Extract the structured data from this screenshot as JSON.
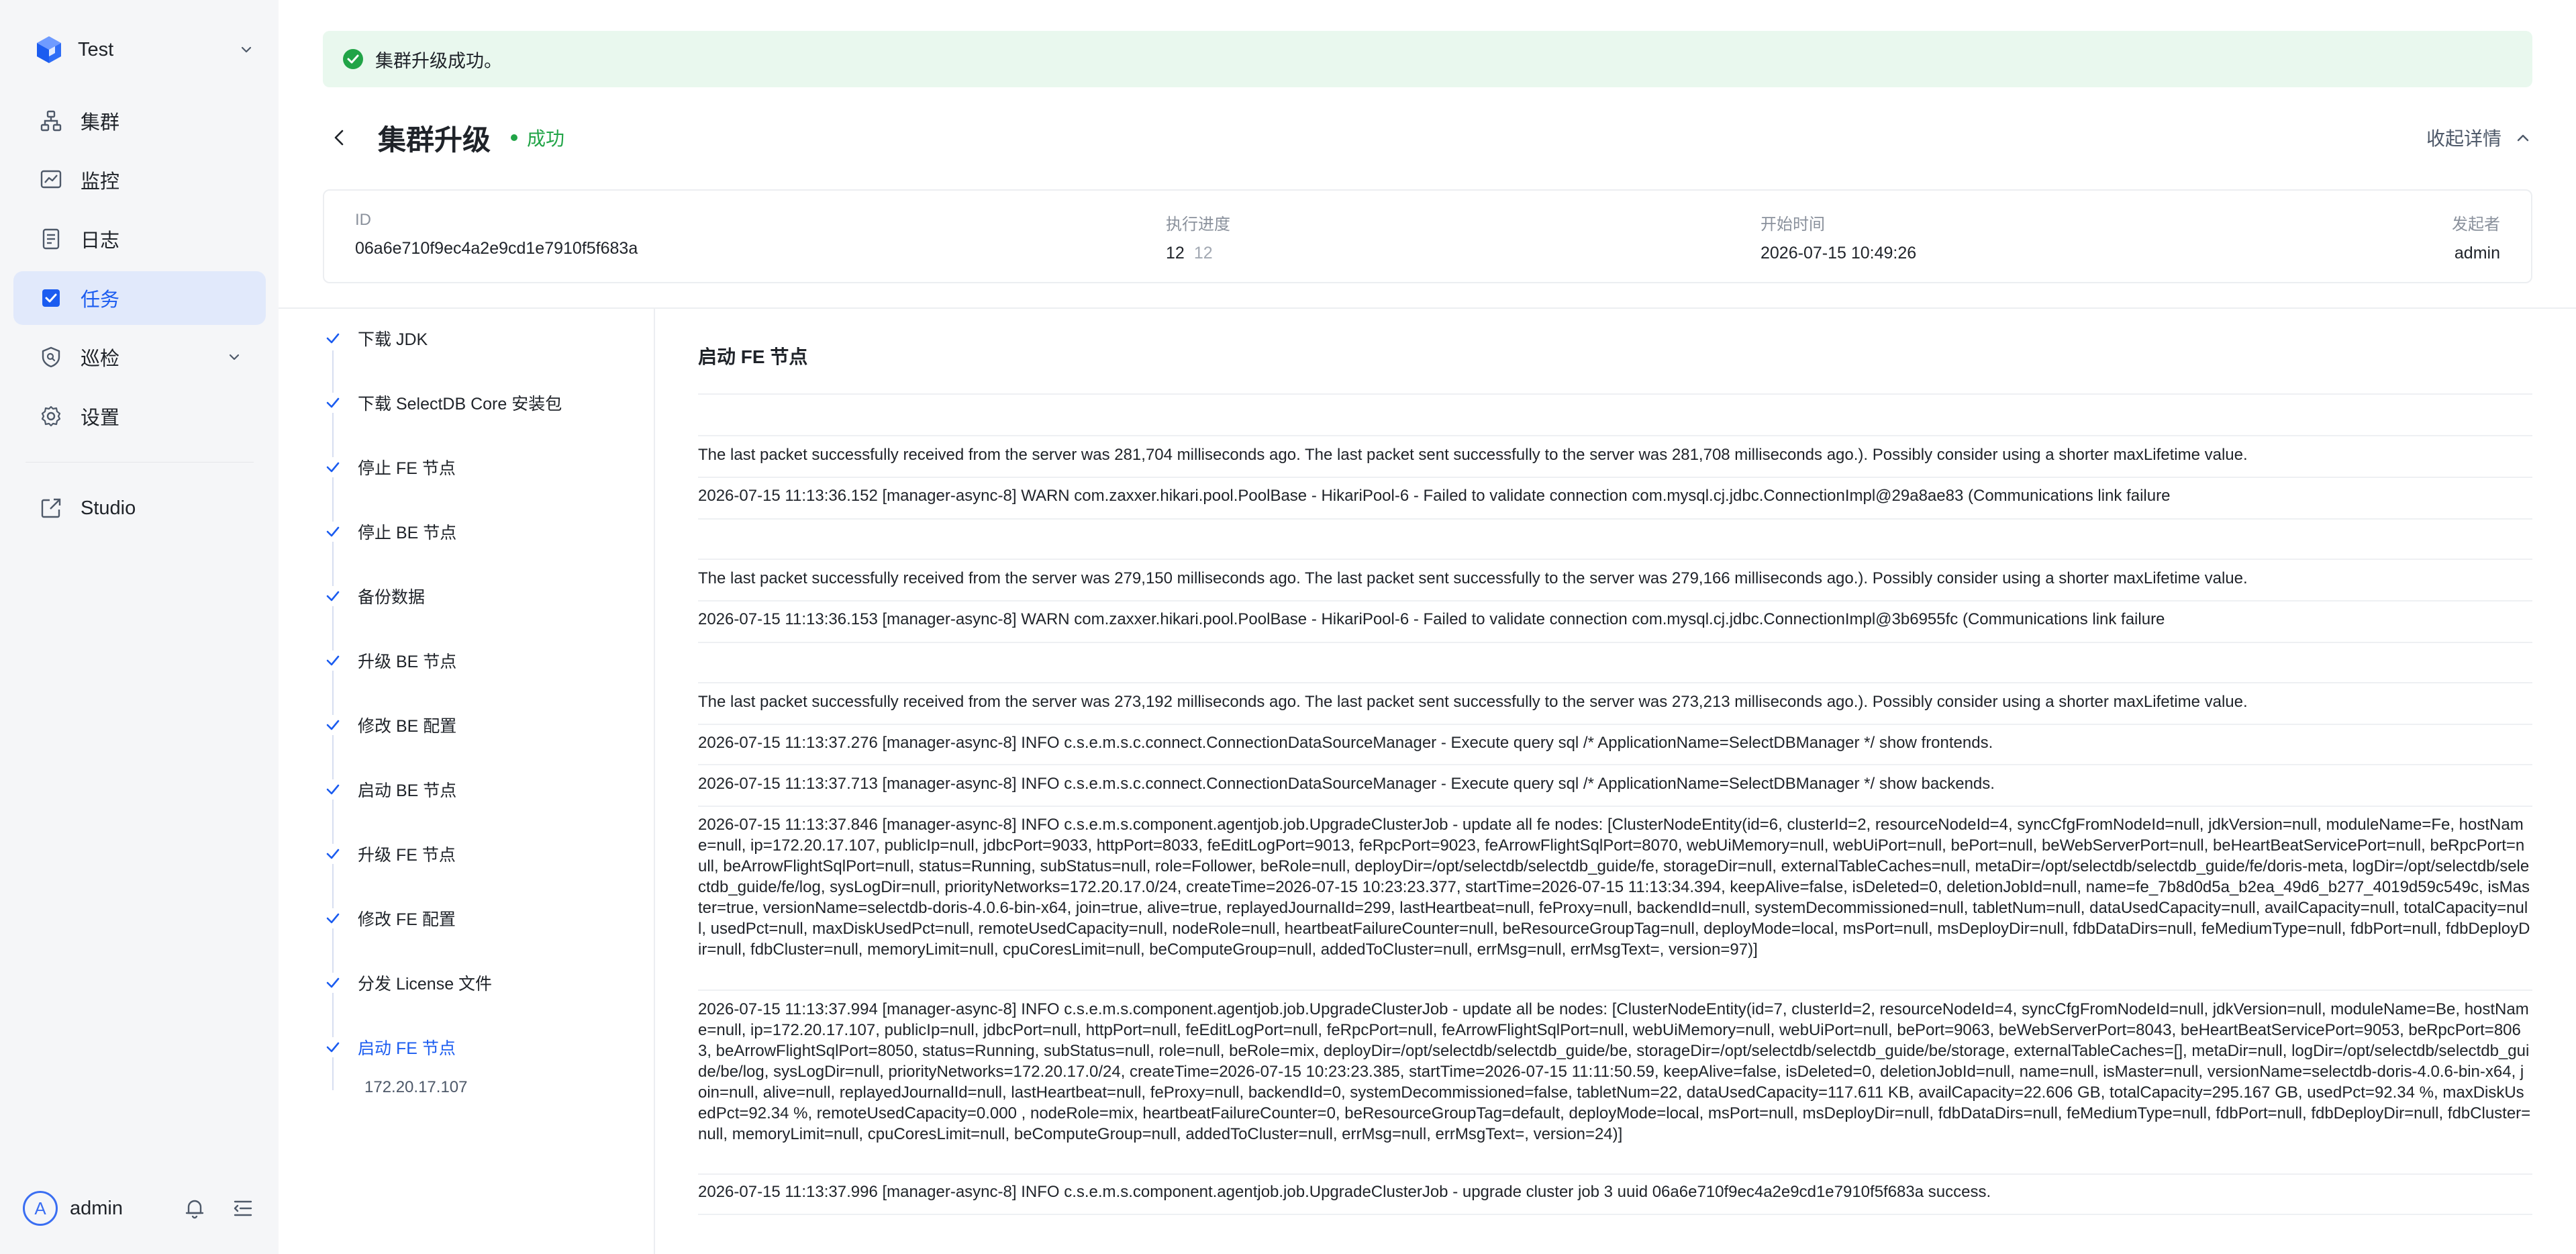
{
  "brand": {
    "name": "Test"
  },
  "nav": {
    "items": [
      {
        "key": "cluster",
        "label": "集群",
        "icon": "cluster-icon"
      },
      {
        "key": "monitor",
        "label": "监控",
        "icon": "monitor-chart-icon"
      },
      {
        "key": "logs",
        "label": "日志",
        "icon": "log-document-icon"
      },
      {
        "key": "tasks",
        "label": "任务",
        "icon": "task-icon",
        "active": true
      },
      {
        "key": "inspection",
        "label": "巡检",
        "icon": "inspection-shield-icon"
      },
      {
        "key": "settings",
        "label": "设置",
        "icon": "gear-icon"
      }
    ],
    "studio": {
      "label": "Studio",
      "icon": "external-link-icon"
    }
  },
  "user": {
    "initial": "A",
    "name": "admin"
  },
  "alert": {
    "text": "集群升级成功。",
    "color": "#21a447"
  },
  "header": {
    "title": "集群升级",
    "status": "成功",
    "collapse_label": "收起详情"
  },
  "info": {
    "id_label": "ID",
    "id_value": "06a6e710f9ec4a2e9cd1e7910f5f683a",
    "progress_label": "执行进度",
    "progress_done": "12",
    "progress_total": "12",
    "start_label": "开始时间",
    "start_value": "2026-07-15 10:49:26",
    "initiator_label": "发起者",
    "initiator_value": "admin"
  },
  "steps": [
    "下载 JDK",
    "下载 SelectDB Core 安装包",
    "停止 FE 节点",
    "停止 BE 节点",
    "备份数据",
    "升级 BE 节点",
    "修改 BE 配置",
    "启动 BE 节点",
    "升级 FE 节点",
    "修改 FE 配置",
    "分发 License 文件",
    "启动 FE 节点"
  ],
  "current_step_node": "172.20.17.107",
  "log": {
    "title": "启动 FE 节点",
    "lines": [
      "The last packet successfully received from the server was 281,704 milliseconds ago. The last packet sent successfully to the server was 281,708 milliseconds ago.). Possibly consider using a shorter maxLifetime value.",
      "2026-07-15 11:13:36.152 [manager-async-8] WARN  com.zaxxer.hikari.pool.PoolBase - HikariPool-6 - Failed to validate connection com.mysql.cj.jdbc.ConnectionImpl@29a8ae83 (Communications link failure",
      "The last packet successfully received from the server was 279,150 milliseconds ago. The last packet sent successfully to the server was 279,166 milliseconds ago.). Possibly consider using a shorter maxLifetime value.",
      "2026-07-15 11:13:36.153 [manager-async-8] WARN  com.zaxxer.hikari.pool.PoolBase - HikariPool-6 - Failed to validate connection com.mysql.cj.jdbc.ConnectionImpl@3b6955fc (Communications link failure",
      "The last packet successfully received from the server was 273,192 milliseconds ago. The last packet sent successfully to the server was 273,213 milliseconds ago.). Possibly consider using a shorter maxLifetime value.",
      "2026-07-15 11:13:37.276 [manager-async-8] INFO  c.s.e.m.s.c.connect.ConnectionDataSourceManager - Execute query sql /* ApplicationName=SelectDBManager */ show frontends.",
      "2026-07-15 11:13:37.713 [manager-async-8] INFO  c.s.e.m.s.c.connect.ConnectionDataSourceManager - Execute query sql /* ApplicationName=SelectDBManager */ show backends.",
      "2026-07-15 11:13:37.846 [manager-async-8] INFO  c.s.e.m.s.component.agentjob.job.UpgradeClusterJob - update all fe nodes: [ClusterNodeEntity(id=6, clusterId=2, resourceNodeId=4, syncCfgFromNodeId=null, jdkVersion=null, moduleName=Fe, hostName=null, ip=172.20.17.107, publicIp=null, jdbcPort=9033, httpPort=8033, feEditLogPort=9013, feRpcPort=9023, feArrowFlightSqlPort=8070, webUiMemory=null, webUiPort=null, bePort=null, beWebServerPort=null, beHeartBeatServicePort=null, beRpcPort=null, beArrowFlightSqlPort=null, status=Running, subStatus=null, role=Follower, beRole=null, deployDir=/opt/selectdb/selectdb_guide/fe, storageDir=null, externalTableCaches=null, metaDir=/opt/selectdb/selectdb_guide/fe/doris-meta, logDir=/opt/selectdb/selectdb_guide/fe/log, sysLogDir=null, priorityNetworks=172.20.17.0/24, createTime=2026-07-15 10:23:23.377, startTime=2026-07-15 11:13:34.394, keepAlive=false, isDeleted=0, deletionJobId=null, name=fe_7b8d0d5a_b2ea_49d6_b277_4019d59c549c, isMaster=true, versionName=selectdb-doris-4.0.6-bin-x64, join=true, alive=true, replayedJournalId=299, lastHeartbeat=null, feProxy=null, backendId=null, systemDecommissioned=null, tabletNum=null, dataUsedCapacity=null, availCapacity=null, totalCapacity=null, usedPct=null, maxDiskUsedPct=null, remoteUsedCapacity=null, nodeRole=null, heartbeatFailureCounter=null, beResourceGroupTag=null, deployMode=local, msPort=null, msDeployDir=null, fdbDataDirs=null, feMediumType=null, fdbPort=null, fdbDeployDir=null, fdbCluster=null, memoryLimit=null, cpuCoresLimit=null, beComputeGroup=null, addedToCluster=null, errMsg=null, errMsgText=, version=97)]",
      "2026-07-15 11:13:37.994 [manager-async-8] INFO  c.s.e.m.s.component.agentjob.job.UpgradeClusterJob - update all be nodes: [ClusterNodeEntity(id=7, clusterId=2, resourceNodeId=4, syncCfgFromNodeId=null, jdkVersion=null, moduleName=Be, hostName=null, ip=172.20.17.107, publicIp=null, jdbcPort=null, httpPort=null, feEditLogPort=null, feRpcPort=null, feArrowFlightSqlPort=null, webUiMemory=null, webUiPort=null, bePort=9063, beWebServerPort=8043, beHeartBeatServicePort=9053, beRpcPort=8063, beArrowFlightSqlPort=8050, status=Running, subStatus=null, role=null, beRole=mix, deployDir=/opt/selectdb/selectdb_guide/be, storageDir=/opt/selectdb/selectdb_guide/be/storage, externalTableCaches=[], metaDir=null, logDir=/opt/selectdb/selectdb_guide/be/log, sysLogDir=null, priorityNetworks=172.20.17.0/24, createTime=2026-07-15 10:23:23.385, startTime=2026-07-15 11:11:50.59, keepAlive=false, isDeleted=0, deletionJobId=null, name=null, isMaster=null, versionName=selectdb-doris-4.0.6-bin-x64, join=null, alive=null, replayedJournalId=null, lastHeartbeat=null, feProxy=null, backendId=0, systemDecommissioned=false, tabletNum=22, dataUsedCapacity=117.611 KB, availCapacity=22.606 GB, totalCapacity=295.167 GB, usedPct=92.34 %, maxDiskUsedPct=92.34 %, remoteUsedCapacity=0.000 , nodeRole=mix, heartbeatFailureCounter=0, beResourceGroupTag=default, deployMode=local, msPort=null, msDeployDir=null, fdbDataDirs=null, feMediumType=null, fdbPort=null, fdbDeployDir=null, fdbCluster=null, memoryLimit=null, cpuCoresLimit=null, beComputeGroup=null, addedToCluster=null, errMsg=null, errMsgText=, version=24)]",
      "2026-07-15 11:13:37.996 [manager-async-8] INFO  c.s.e.m.s.component.agentjob.job.UpgradeClusterJob - upgrade cluster job 3 uuid 06a6e710f9ec4a2e9cd1e7910f5f683a success."
    ]
  },
  "colors": {
    "accent": "#1b5cf0",
    "success": "#21a447",
    "active_bg": "#e1e9fb",
    "sidebar_bg": "#f5f6f8"
  }
}
